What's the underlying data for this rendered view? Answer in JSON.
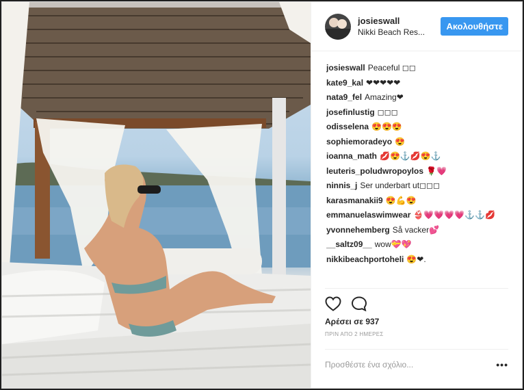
{
  "post": {
    "username": "josieswall",
    "location": "Nikki Beach Res...",
    "follow_label": "Ακολουθήστε",
    "likes_text": "Αρέσει σε 937",
    "time_ago": "ΠΡΙΝ ΑΠΟ 2 ΗΜΕΡΕΣ",
    "comment_placeholder": "Προσθέστε ένα σχόλιο...",
    "more_label": "•••"
  },
  "comments": [
    {
      "user": "josieswall",
      "text": "Peaceful ◻◻"
    },
    {
      "user": "kate9_kal",
      "text": "❤❤❤❤❤"
    },
    {
      "user": "nata9_fel",
      "text": "Amazing❤"
    },
    {
      "user": "josefinlustig",
      "text": "◻◻◻"
    },
    {
      "user": "odisselena",
      "text": "😍😍😍"
    },
    {
      "user": "sophiemoradeyo",
      "text": "😍"
    },
    {
      "user": "ioanna_math",
      "text": "💋😍⚓💋😍⚓"
    },
    {
      "user": "leuteris_poludwropoylos",
      "text": "🌹💗"
    },
    {
      "user": "ninnis_j",
      "text": "Ser underbart ut◻◻◻"
    },
    {
      "user": "karasmanakii9",
      "text": "😍💪😍"
    },
    {
      "user": "emmanuelaswimwear",
      "text": "👙💗💗💗💗⚓⚓💋"
    },
    {
      "user": "yvonnehemberg",
      "text": "Så vacker💕"
    },
    {
      "user": "__saltz09__",
      "text": "wow💝💖"
    },
    {
      "user": "nikkibeachportoheli",
      "text": "😍❤."
    }
  ],
  "icons": {
    "like": "heart-icon",
    "comment": "comment-icon"
  },
  "colors": {
    "follow_button": "#3897f0"
  }
}
